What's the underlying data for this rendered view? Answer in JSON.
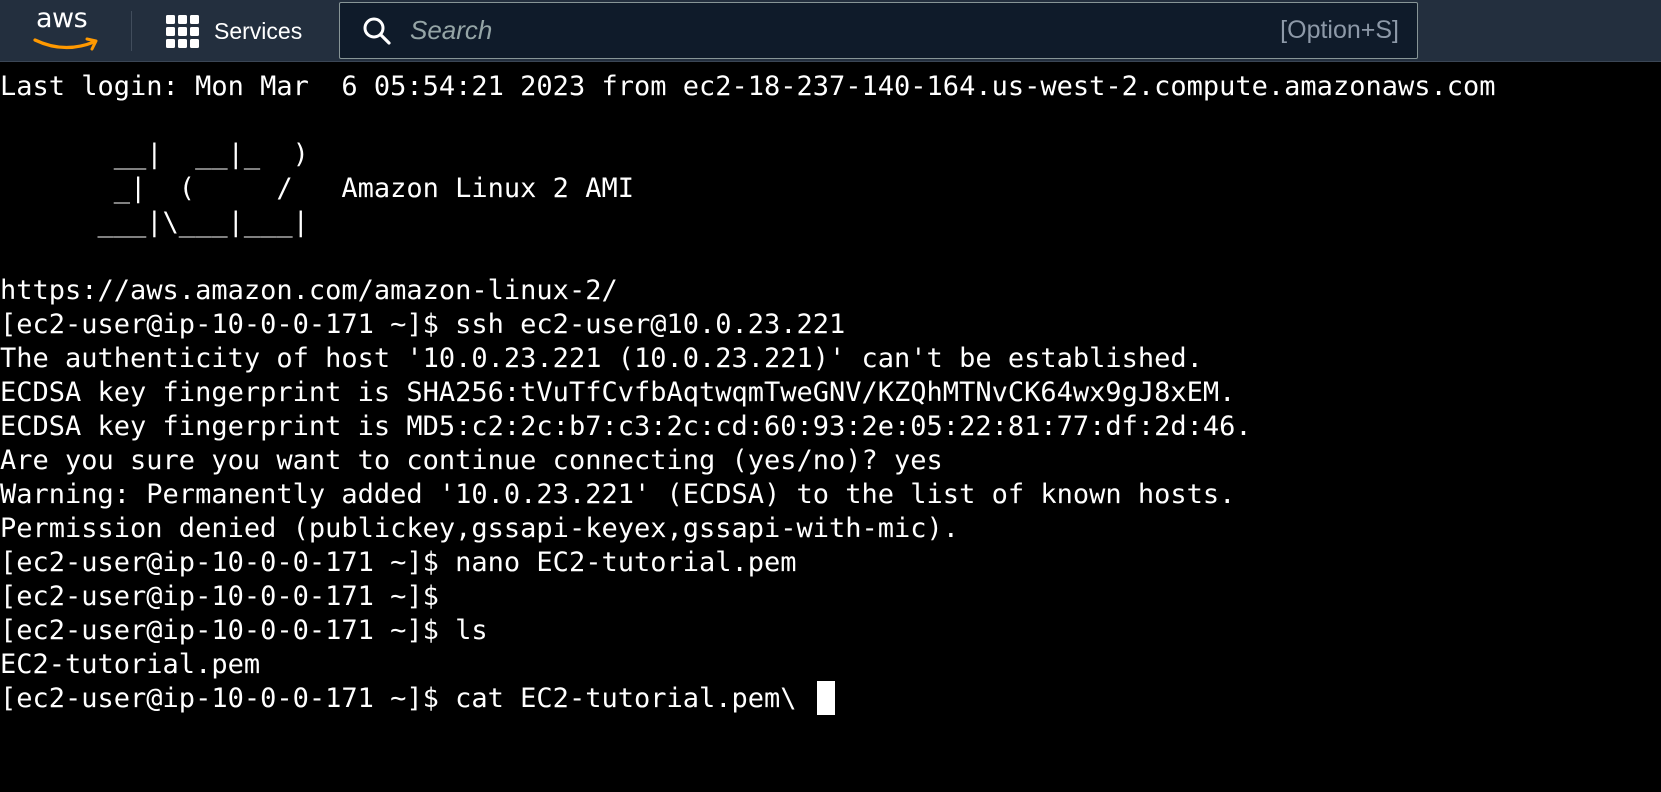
{
  "nav": {
    "logo_text": "aws",
    "services_label": "Services",
    "search": {
      "placeholder": "Search",
      "value": "",
      "shortcut": "[Option+S]"
    }
  },
  "terminal": {
    "lines": [
      "Last login: Mon Mar  6 05:54:21 2023 from ec2-18-237-140-164.us-west-2.compute.amazonaws.com",
      "",
      "       __|  __|_  )",
      "       _|  (     /   Amazon Linux 2 AMI",
      "      ___|\\___|___|",
      "",
      "https://aws.amazon.com/amazon-linux-2/",
      "[ec2-user@ip-10-0-0-171 ~]$ ssh ec2-user@10.0.23.221",
      "The authenticity of host '10.0.23.221 (10.0.23.221)' can't be established.",
      "ECDSA key fingerprint is SHA256:tVuTfCvfbAqtwqmTweGNV/KZQhMTNvCK64wx9gJ8xEM.",
      "ECDSA key fingerprint is MD5:c2:2c:b7:c3:2c:cd:60:93:2e:05:22:81:77:df:2d:46.",
      "Are you sure you want to continue connecting (yes/no)? yes",
      "Warning: Permanently added '10.0.23.221' (ECDSA) to the list of known hosts.",
      "Permission denied (publickey,gssapi-keyex,gssapi-with-mic).",
      "[ec2-user@ip-10-0-0-171 ~]$ nano EC2-tutorial.pem",
      "[ec2-user@ip-10-0-0-171 ~]$",
      "[ec2-user@ip-10-0-0-171 ~]$ ls",
      "EC2-tutorial.pem",
      "[ec2-user@ip-10-0-0-171 ~]$ cat EC2-tutorial.pem\\"
    ]
  },
  "colors": {
    "nav_background": "#232f3e",
    "terminal_background": "#000000",
    "terminal_text": "#ffffff",
    "aws_smile": "#ff9900"
  }
}
